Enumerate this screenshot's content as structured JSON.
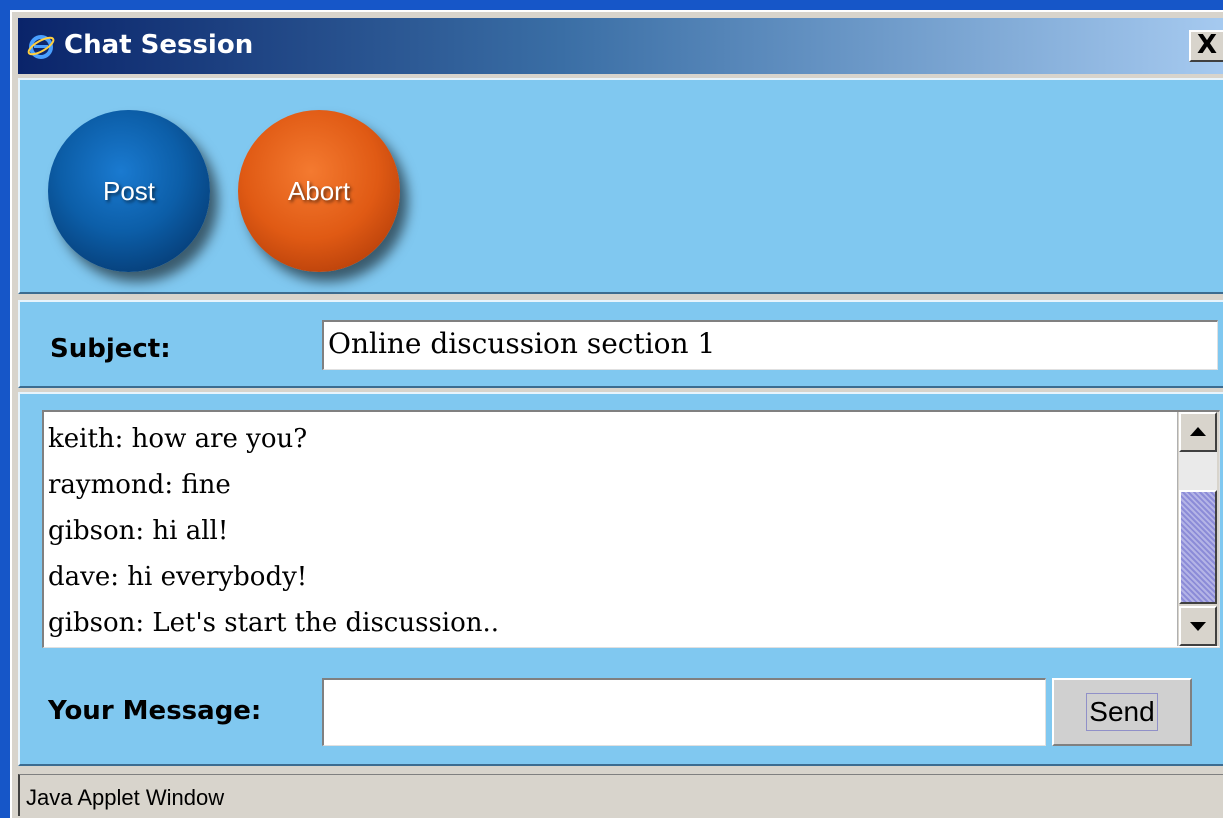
{
  "window": {
    "title": "Chat Session",
    "close_symbol": "X",
    "status_text": "Java Applet Window"
  },
  "toolbar": {
    "post_label": "Post",
    "abort_label": "Abort"
  },
  "subject": {
    "label": "Subject:",
    "value": "Online discussion section 1"
  },
  "chat": {
    "messages": [
      "keith: how are you?",
      "raymond: fine",
      "gibson: hi all!",
      "dave: hi everybody!",
      "gibson: Let's start the discussion.."
    ]
  },
  "compose": {
    "label": "Your Message:",
    "value": "",
    "send_label": "Send"
  },
  "icons": {
    "title_icon": "ie-logo-icon",
    "scroll_up": "triangle-up-icon",
    "scroll_down": "triangle-down-icon"
  },
  "colors": {
    "desktop": "#1656c8",
    "panel": "#80c8f0",
    "post_button": "#0c5ea8",
    "abort_button": "#e05a14"
  }
}
